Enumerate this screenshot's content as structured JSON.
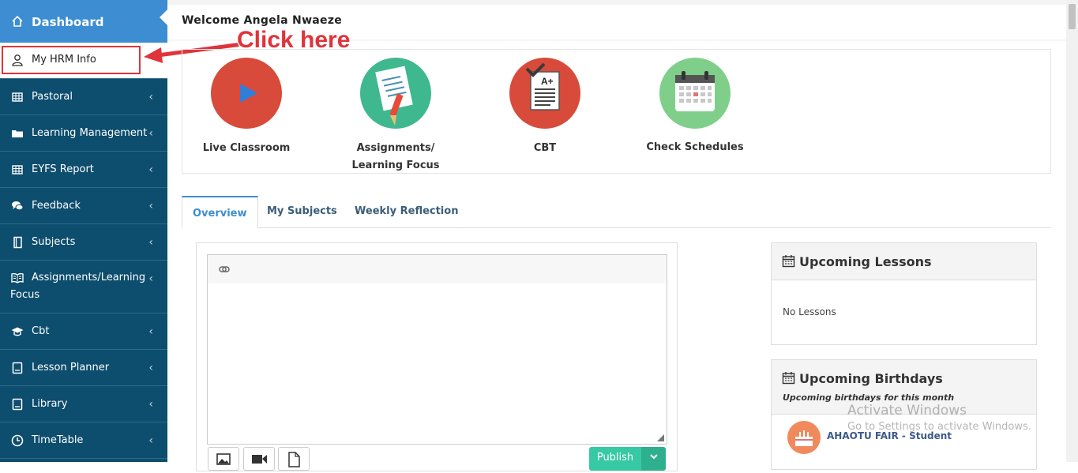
{
  "sidebar": {
    "items": [
      {
        "label": "Dashboard",
        "icon": "home-icon"
      },
      {
        "label": "My HRM Info",
        "icon": "user-icon"
      },
      {
        "label": "Pastoral",
        "icon": "table-icon"
      },
      {
        "label": "Learning Management",
        "icon": "folder-icon"
      },
      {
        "label": "EYFS Report",
        "icon": "table-icon"
      },
      {
        "label": "Feedback",
        "icon": "comments-icon"
      },
      {
        "label": "Subjects",
        "icon": "book-icon"
      },
      {
        "label": "Assignments/Learning",
        "label2": "Focus",
        "icon": "open-book-icon"
      },
      {
        "label": "Cbt",
        "icon": "graduation-cap-icon"
      },
      {
        "label": "Lesson Planner",
        "icon": "planner-icon"
      },
      {
        "label": "Library",
        "icon": "library-icon"
      },
      {
        "label": "TimeTable",
        "icon": "clock-icon"
      }
    ],
    "chevron": "‹"
  },
  "header": {
    "welcome": "Welcome Angela Nwaeze"
  },
  "annotation": {
    "text": "Click here",
    "color": "#e0333a"
  },
  "shortcuts": [
    {
      "label": "Live Classroom",
      "icon": "play-icon"
    },
    {
      "label": "Assignments/",
      "label2": "Learning Focus",
      "icon": "notepad-pencil-icon"
    },
    {
      "label": "CBT",
      "icon": "graded-test-icon"
    },
    {
      "label": "Check Schedules",
      "icon": "calendar-icon"
    }
  ],
  "tabs": [
    "Overview",
    "My Subjects",
    "Weekly Reflection"
  ],
  "editor": {
    "publish": "Publish"
  },
  "upcoming_lessons": {
    "title": "Upcoming Lessons",
    "empty": "No Lessons"
  },
  "upcoming_birthdays": {
    "title": "Upcoming Birthdays",
    "subtitle": "Upcoming birthdays for this month",
    "first": "AHAOTU FAIR - Student"
  },
  "watermark": {
    "line1": "Activate Windows",
    "line2": "Go to Settings to activate Windows."
  },
  "colors": {
    "sidebar": "#0d4d6e",
    "active": "#3c8dd1",
    "publish": "#37c9a3"
  }
}
